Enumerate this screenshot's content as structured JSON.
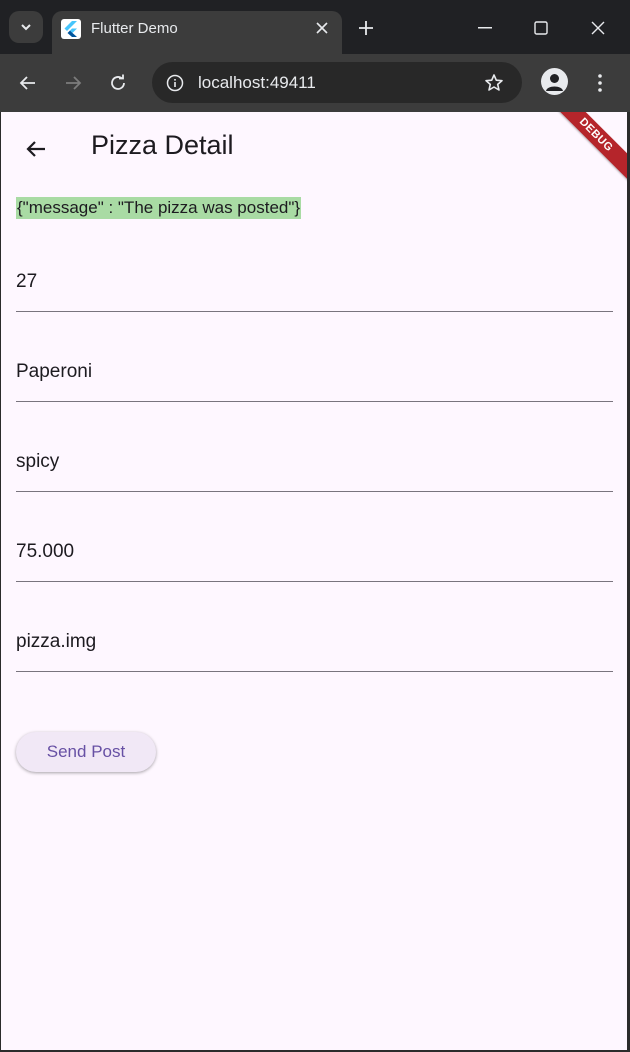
{
  "browser": {
    "tab_title": "Flutter Demo",
    "url": "localhost:49411"
  },
  "app": {
    "title": "Pizza Detail",
    "debug_ribbon": "DEBUG",
    "message": "{\"message\" : \"The pizza was posted\"}",
    "fields": [
      {
        "value": "27"
      },
      {
        "value": "Paperoni"
      },
      {
        "value": "spicy"
      },
      {
        "value": "75.000"
      },
      {
        "value": "pizza.img"
      }
    ],
    "send_button": "Send Post"
  },
  "colors": {
    "app_background": "#fef7ff",
    "message_highlight": "#a9dba4",
    "button_text": "#6750a4",
    "debug_ribbon": "#b5252b"
  }
}
